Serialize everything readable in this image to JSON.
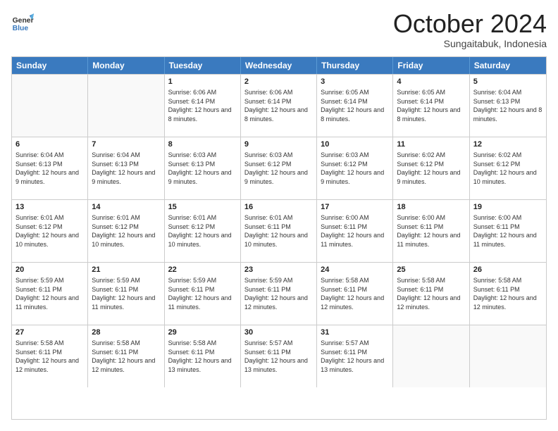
{
  "header": {
    "logo_line1": "General",
    "logo_line2": "Blue",
    "month_title": "October 2024",
    "location": "Sungaitabuk, Indonesia"
  },
  "days_of_week": [
    "Sunday",
    "Monday",
    "Tuesday",
    "Wednesday",
    "Thursday",
    "Friday",
    "Saturday"
  ],
  "weeks": [
    [
      {
        "day": "",
        "sunrise": "",
        "sunset": "",
        "daylight": ""
      },
      {
        "day": "",
        "sunrise": "",
        "sunset": "",
        "daylight": ""
      },
      {
        "day": "1",
        "sunrise": "Sunrise: 6:06 AM",
        "sunset": "Sunset: 6:14 PM",
        "daylight": "Daylight: 12 hours and 8 minutes."
      },
      {
        "day": "2",
        "sunrise": "Sunrise: 6:06 AM",
        "sunset": "Sunset: 6:14 PM",
        "daylight": "Daylight: 12 hours and 8 minutes."
      },
      {
        "day": "3",
        "sunrise": "Sunrise: 6:05 AM",
        "sunset": "Sunset: 6:14 PM",
        "daylight": "Daylight: 12 hours and 8 minutes."
      },
      {
        "day": "4",
        "sunrise": "Sunrise: 6:05 AM",
        "sunset": "Sunset: 6:14 PM",
        "daylight": "Daylight: 12 hours and 8 minutes."
      },
      {
        "day": "5",
        "sunrise": "Sunrise: 6:04 AM",
        "sunset": "Sunset: 6:13 PM",
        "daylight": "Daylight: 12 hours and 8 minutes."
      }
    ],
    [
      {
        "day": "6",
        "sunrise": "Sunrise: 6:04 AM",
        "sunset": "Sunset: 6:13 PM",
        "daylight": "Daylight: 12 hours and 9 minutes."
      },
      {
        "day": "7",
        "sunrise": "Sunrise: 6:04 AM",
        "sunset": "Sunset: 6:13 PM",
        "daylight": "Daylight: 12 hours and 9 minutes."
      },
      {
        "day": "8",
        "sunrise": "Sunrise: 6:03 AM",
        "sunset": "Sunset: 6:13 PM",
        "daylight": "Daylight: 12 hours and 9 minutes."
      },
      {
        "day": "9",
        "sunrise": "Sunrise: 6:03 AM",
        "sunset": "Sunset: 6:12 PM",
        "daylight": "Daylight: 12 hours and 9 minutes."
      },
      {
        "day": "10",
        "sunrise": "Sunrise: 6:03 AM",
        "sunset": "Sunset: 6:12 PM",
        "daylight": "Daylight: 12 hours and 9 minutes."
      },
      {
        "day": "11",
        "sunrise": "Sunrise: 6:02 AM",
        "sunset": "Sunset: 6:12 PM",
        "daylight": "Daylight: 12 hours and 9 minutes."
      },
      {
        "day": "12",
        "sunrise": "Sunrise: 6:02 AM",
        "sunset": "Sunset: 6:12 PM",
        "daylight": "Daylight: 12 hours and 10 minutes."
      }
    ],
    [
      {
        "day": "13",
        "sunrise": "Sunrise: 6:01 AM",
        "sunset": "Sunset: 6:12 PM",
        "daylight": "Daylight: 12 hours and 10 minutes."
      },
      {
        "day": "14",
        "sunrise": "Sunrise: 6:01 AM",
        "sunset": "Sunset: 6:12 PM",
        "daylight": "Daylight: 12 hours and 10 minutes."
      },
      {
        "day": "15",
        "sunrise": "Sunrise: 6:01 AM",
        "sunset": "Sunset: 6:12 PM",
        "daylight": "Daylight: 12 hours and 10 minutes."
      },
      {
        "day": "16",
        "sunrise": "Sunrise: 6:01 AM",
        "sunset": "Sunset: 6:11 PM",
        "daylight": "Daylight: 12 hours and 10 minutes."
      },
      {
        "day": "17",
        "sunrise": "Sunrise: 6:00 AM",
        "sunset": "Sunset: 6:11 PM",
        "daylight": "Daylight: 12 hours and 11 minutes."
      },
      {
        "day": "18",
        "sunrise": "Sunrise: 6:00 AM",
        "sunset": "Sunset: 6:11 PM",
        "daylight": "Daylight: 12 hours and 11 minutes."
      },
      {
        "day": "19",
        "sunrise": "Sunrise: 6:00 AM",
        "sunset": "Sunset: 6:11 PM",
        "daylight": "Daylight: 12 hours and 11 minutes."
      }
    ],
    [
      {
        "day": "20",
        "sunrise": "Sunrise: 5:59 AM",
        "sunset": "Sunset: 6:11 PM",
        "daylight": "Daylight: 12 hours and 11 minutes."
      },
      {
        "day": "21",
        "sunrise": "Sunrise: 5:59 AM",
        "sunset": "Sunset: 6:11 PM",
        "daylight": "Daylight: 12 hours and 11 minutes."
      },
      {
        "day": "22",
        "sunrise": "Sunrise: 5:59 AM",
        "sunset": "Sunset: 6:11 PM",
        "daylight": "Daylight: 12 hours and 11 minutes."
      },
      {
        "day": "23",
        "sunrise": "Sunrise: 5:59 AM",
        "sunset": "Sunset: 6:11 PM",
        "daylight": "Daylight: 12 hours and 12 minutes."
      },
      {
        "day": "24",
        "sunrise": "Sunrise: 5:58 AM",
        "sunset": "Sunset: 6:11 PM",
        "daylight": "Daylight: 12 hours and 12 minutes."
      },
      {
        "day": "25",
        "sunrise": "Sunrise: 5:58 AM",
        "sunset": "Sunset: 6:11 PM",
        "daylight": "Daylight: 12 hours and 12 minutes."
      },
      {
        "day": "26",
        "sunrise": "Sunrise: 5:58 AM",
        "sunset": "Sunset: 6:11 PM",
        "daylight": "Daylight: 12 hours and 12 minutes."
      }
    ],
    [
      {
        "day": "27",
        "sunrise": "Sunrise: 5:58 AM",
        "sunset": "Sunset: 6:11 PM",
        "daylight": "Daylight: 12 hours and 12 minutes."
      },
      {
        "day": "28",
        "sunrise": "Sunrise: 5:58 AM",
        "sunset": "Sunset: 6:11 PM",
        "daylight": "Daylight: 12 hours and 12 minutes."
      },
      {
        "day": "29",
        "sunrise": "Sunrise: 5:58 AM",
        "sunset": "Sunset: 6:11 PM",
        "daylight": "Daylight: 12 hours and 13 minutes."
      },
      {
        "day": "30",
        "sunrise": "Sunrise: 5:57 AM",
        "sunset": "Sunset: 6:11 PM",
        "daylight": "Daylight: 12 hours and 13 minutes."
      },
      {
        "day": "31",
        "sunrise": "Sunrise: 5:57 AM",
        "sunset": "Sunset: 6:11 PM",
        "daylight": "Daylight: 12 hours and 13 minutes."
      },
      {
        "day": "",
        "sunrise": "",
        "sunset": "",
        "daylight": ""
      },
      {
        "day": "",
        "sunrise": "",
        "sunset": "",
        "daylight": ""
      }
    ]
  ]
}
